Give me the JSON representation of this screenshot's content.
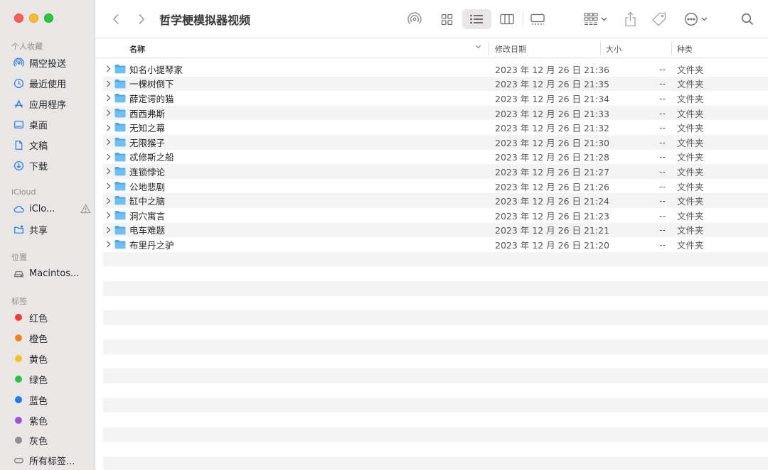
{
  "window": {
    "title": "哲学梗模拟器视频"
  },
  "sidebar": {
    "sections": [
      {
        "label": "个人收藏"
      },
      {
        "label": "iCloud"
      },
      {
        "label": "位置"
      },
      {
        "label": "标签"
      }
    ],
    "favorites": [
      {
        "label": "隔空投送",
        "icon": "airdrop-icon"
      },
      {
        "label": "最近使用",
        "icon": "clock-icon"
      },
      {
        "label": "应用程序",
        "icon": "applications-icon"
      },
      {
        "label": "桌面",
        "icon": "desktop-icon"
      },
      {
        "label": "文稿",
        "icon": "document-icon"
      },
      {
        "label": "下载",
        "icon": "download-icon"
      }
    ],
    "icloud": [
      {
        "label": "iClo...",
        "icon": "cloud-icon"
      },
      {
        "label": "共享",
        "icon": "shared-folder-icon"
      }
    ],
    "locations": [
      {
        "label": "Macintos...",
        "icon": "disk-icon"
      }
    ],
    "tags": [
      {
        "label": "红色",
        "color": "#f5373a"
      },
      {
        "label": "橙色",
        "color": "#f7821b"
      },
      {
        "label": "黄色",
        "color": "#f7c01a"
      },
      {
        "label": "绿色",
        "color": "#2ac53f"
      },
      {
        "label": "蓝色",
        "color": "#1d7bf5"
      },
      {
        "label": "紫色",
        "color": "#a550d4"
      },
      {
        "label": "灰色",
        "color": "#8e8e93"
      },
      {
        "label": "所有标签..."
      }
    ]
  },
  "columns": {
    "name": "名称",
    "date": "修改日期",
    "size": "大小",
    "kind": "种类"
  },
  "files": [
    {
      "name": "知名小提琴家",
      "date": "2023 年 12 月 26 日 21:36",
      "size": "--",
      "kind": "文件夹"
    },
    {
      "name": "一棵树倒下",
      "date": "2023 年 12 月 26 日 21:35",
      "size": "--",
      "kind": "文件夹"
    },
    {
      "name": "薛定谔的猫",
      "date": "2023 年 12 月 26 日 21:34",
      "size": "--",
      "kind": "文件夹"
    },
    {
      "name": "西西弗斯",
      "date": "2023 年 12 月 26 日 21:33",
      "size": "--",
      "kind": "文件夹"
    },
    {
      "name": "无知之幕",
      "date": "2023 年 12 月 26 日 21:32",
      "size": "--",
      "kind": "文件夹"
    },
    {
      "name": "无限猴子",
      "date": "2023 年 12 月 26 日 21:30",
      "size": "--",
      "kind": "文件夹"
    },
    {
      "name": "忒修斯之船",
      "date": "2023 年 12 月 26 日 21:28",
      "size": "--",
      "kind": "文件夹"
    },
    {
      "name": "连锁悖论",
      "date": "2023 年 12 月 26 日 21:27",
      "size": "--",
      "kind": "文件夹"
    },
    {
      "name": "公地悲剧",
      "date": "2023 年 12 月 26 日 21:26",
      "size": "--",
      "kind": "文件夹"
    },
    {
      "name": "缸中之脑",
      "date": "2023 年 12 月 26 日 21:24",
      "size": "--",
      "kind": "文件夹"
    },
    {
      "name": "洞穴寓言",
      "date": "2023 年 12 月 26 日 21:23",
      "size": "--",
      "kind": "文件夹"
    },
    {
      "name": "电车难题",
      "date": "2023 年 12 月 26 日 21:21",
      "size": "--",
      "kind": "文件夹"
    },
    {
      "name": "布里丹之驴",
      "date": "2023 年 12 月 26 日 21:20",
      "size": "--",
      "kind": "文件夹"
    }
  ],
  "colors": {
    "accent": "#1d7bf5",
    "folder": "#5fb3ee"
  }
}
